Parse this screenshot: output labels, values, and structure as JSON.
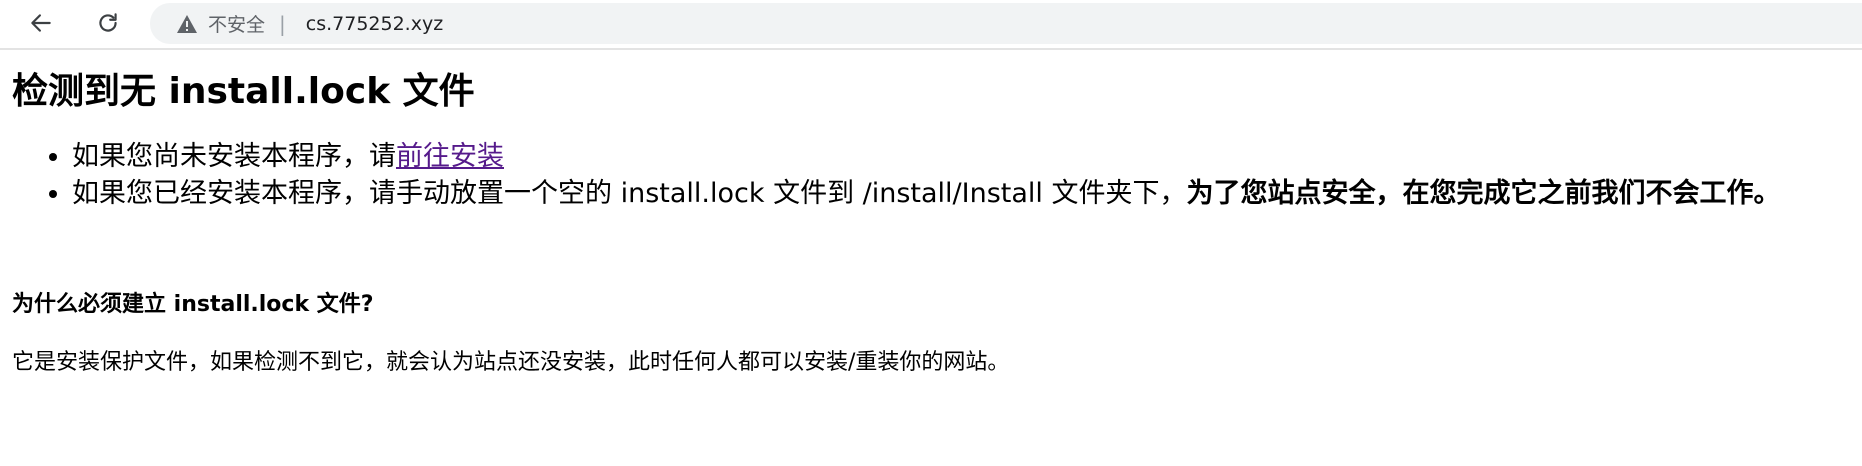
{
  "browser": {
    "security_label": "不安全",
    "separator": "|",
    "url": "cs.775252.xyz"
  },
  "page": {
    "heading": "检测到无 install.lock 文件",
    "items": [
      {
        "text": "如果您尚未安装本程序，请",
        "link": "前往安装"
      },
      {
        "text": "如果您已经安装本程序，请手动放置一个空的 install.lock 文件到 /install/Install 文件夹下，",
        "bold": "为了您站点安全，在您完成它之前我们不会工作。"
      }
    ],
    "why_heading": "为什么必须建立 install.lock 文件?",
    "why_text": "它是安装保护文件，如果检测不到它，就会认为站点还没安装，此时任何人都可以安装/重装你的网站。"
  },
  "colors": {
    "link": "#551a8b",
    "omnibox_bg": "#f1f3f4"
  },
  "icons": [
    "back-arrow-icon",
    "reload-icon",
    "warning-triangle-icon"
  ]
}
